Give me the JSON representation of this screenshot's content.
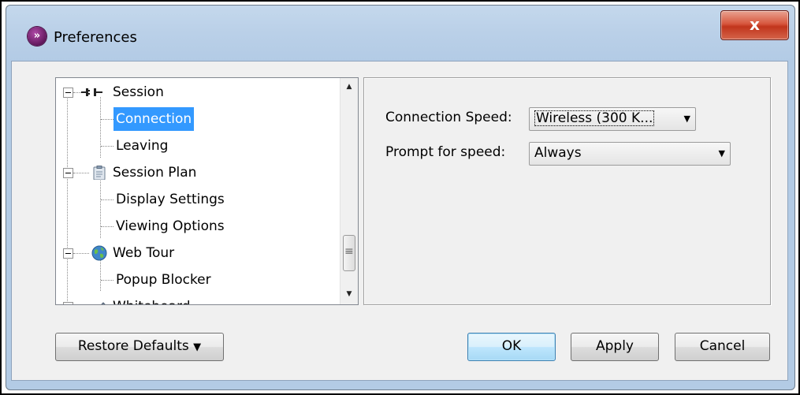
{
  "window": {
    "title": "Preferences",
    "app_icon": "chevron-circle-icon",
    "close_label": "x"
  },
  "tree": {
    "items": [
      {
        "label": "Session",
        "icon": "plug-icon",
        "expandable": true,
        "level": 0
      },
      {
        "label": "Connection",
        "selected": true,
        "level": 1
      },
      {
        "label": "Leaving",
        "level": 1
      },
      {
        "label": "Session Plan",
        "icon": "clipboard-icon",
        "expandable": true,
        "level": 0
      },
      {
        "label": "Display Settings",
        "level": 1
      },
      {
        "label": "Viewing Options",
        "level": 1
      },
      {
        "label": "Web Tour",
        "icon": "globe-icon",
        "expandable": true,
        "level": 0
      },
      {
        "label": "Popup Blocker",
        "level": 1
      },
      {
        "label": "Whiteboard",
        "icon": "pencil-icon",
        "expandable": true,
        "level": 0
      }
    ]
  },
  "settings": {
    "connection_speed_label": "Connection Speed:",
    "connection_speed_value": "Wireless (300 K...",
    "prompt_label": "Prompt for speed:",
    "prompt_value": "Always"
  },
  "buttons": {
    "restore_defaults": "Restore Defaults",
    "ok": "OK",
    "apply": "Apply",
    "cancel": "Cancel"
  },
  "colors": {
    "selection": "#3399ff",
    "close_button": "#c1351c",
    "title_bar": "#bad0e8"
  }
}
